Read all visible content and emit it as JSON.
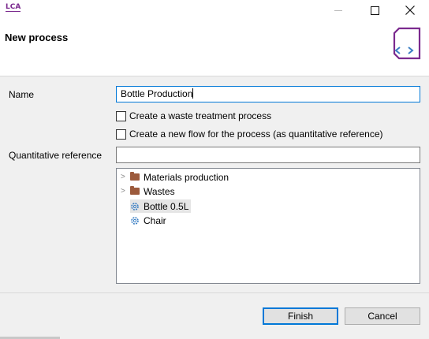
{
  "window": {
    "app_icon_text": "LCA",
    "controls": {
      "minimize": "minimize",
      "maximize": "maximize",
      "close": "close"
    }
  },
  "header": {
    "title": "New process",
    "icon": "new-process-wizard-icon",
    "accent_color": "#7b2a8e"
  },
  "form": {
    "name_label": "Name",
    "name_value": "Bottle Production",
    "waste_checkbox_label": "Create a waste treatment process",
    "waste_checkbox_checked": false,
    "flow_checkbox_label": "Create a new flow for the process (as quantitative reference)",
    "flow_checkbox_checked": false,
    "quant_ref_label": "Quantitative reference",
    "quant_ref_value": ""
  },
  "tree": {
    "items": [
      {
        "label": "Materials production",
        "type": "folder",
        "expandable": true
      },
      {
        "label": "Wastes",
        "type": "folder",
        "expandable": true
      },
      {
        "label": "Bottle 0.5L",
        "type": "flow",
        "selected": true
      },
      {
        "label": "Chair",
        "type": "flow",
        "selected": false
      }
    ]
  },
  "buttons": {
    "finish": "Finish",
    "cancel": "Cancel"
  }
}
